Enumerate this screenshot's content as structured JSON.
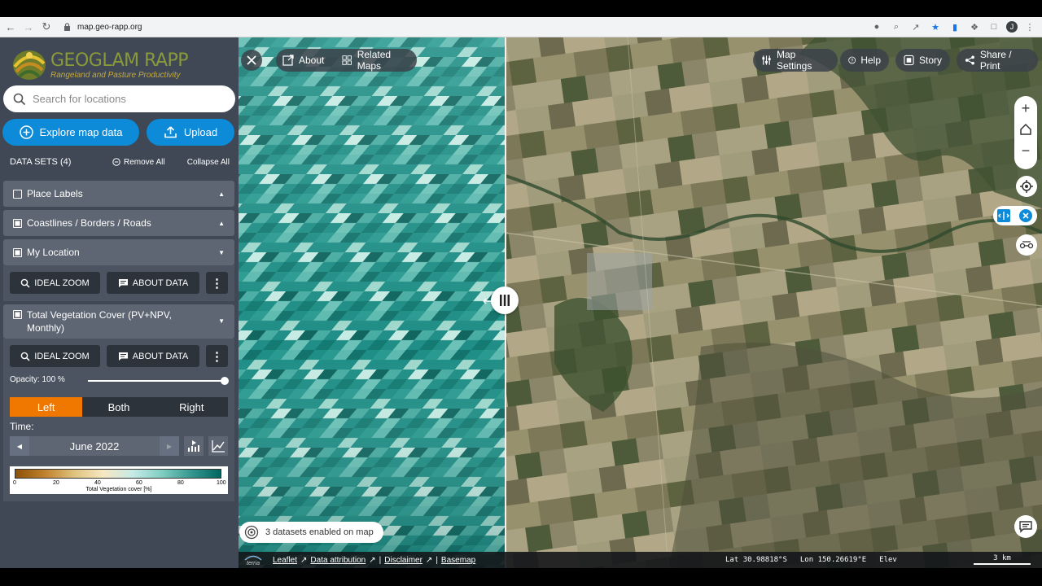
{
  "browser": {
    "url": "map.geo-rapp.org",
    "avatar_initial": "J"
  },
  "brand": {
    "title": "GEOGLAM RAPP",
    "subtitle": "Rangeland and Pasture Productivity"
  },
  "search": {
    "placeholder": "Search for locations"
  },
  "actions": {
    "explore_label": "Explore map data",
    "upload_label": "Upload"
  },
  "datasets": {
    "header": "DATA SETS (4)",
    "remove_all": "Remove All",
    "collapse_all": "Collapse All",
    "items": [
      {
        "label": "Place Labels",
        "checked": false,
        "expanded": false
      },
      {
        "label": "Coastlines / Borders / Roads",
        "checked": true,
        "expanded": false
      },
      {
        "label": "My Location",
        "checked": true,
        "expanded": true
      },
      {
        "label": "Total Vegetation Cover (PV+NPV, Monthly)",
        "label_line1": "Total Vegetation Cover (PV+NPV,",
        "label_line2": "Monthly)",
        "checked": true,
        "expanded": true
      }
    ],
    "ideal_zoom_label": "IDEAL ZOOM",
    "about_data_label": "ABOUT DATA"
  },
  "vegetation": {
    "opacity_label": "Opacity: 100 %",
    "opacity_value": 1.0,
    "split_tabs": [
      "Left",
      "Both",
      "Right"
    ],
    "active_tab": "Left",
    "time_label": "Time:",
    "time_value": "June 2022",
    "legend": {
      "ticks": [
        "0",
        "20",
        "40",
        "60",
        "80",
        "100"
      ],
      "title": "Total Vegetation cover [%]",
      "colors": [
        "#8c510a",
        "#bf812d",
        "#dfc27d",
        "#f6e8c3",
        "#c7eae5",
        "#80cdc1",
        "#35978f",
        "#01665e"
      ]
    }
  },
  "map": {
    "top_left": {
      "about": "About",
      "related_maps": "Related Maps"
    },
    "top_right": {
      "map_settings": "Map Settings",
      "help": "Help",
      "story": "Story",
      "share_print": "Share / Print"
    },
    "datasets_enabled": "3 datasets enabled on map",
    "split_position": 0.332
  },
  "footer": {
    "brand": "terria",
    "links": [
      "Leaflet",
      "Data attribution",
      "Disclaimer",
      "Basemap"
    ],
    "lat_label": "Lat",
    "lat_value": "30.98818°S",
    "lon_label": "Lon",
    "lon_value": "150.26619°E",
    "elev_label": "Elev",
    "scale_label": "3 km"
  },
  "colors": {
    "accent": "#0d8ad8",
    "active_tab": "#f07800",
    "panel": "#3f4854"
  }
}
